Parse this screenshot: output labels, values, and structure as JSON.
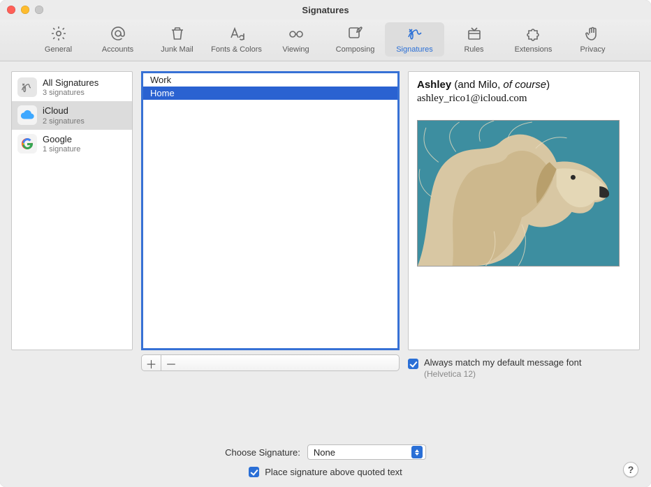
{
  "window": {
    "title": "Signatures"
  },
  "toolbar": {
    "items": [
      {
        "id": "general",
        "label": "General",
        "icon": "gear-icon"
      },
      {
        "id": "accounts",
        "label": "Accounts",
        "icon": "at-icon"
      },
      {
        "id": "junk",
        "label": "Junk Mail",
        "icon": "trash-icon"
      },
      {
        "id": "fonts",
        "label": "Fonts & Colors",
        "icon": "fonts-icon"
      },
      {
        "id": "viewing",
        "label": "Viewing",
        "icon": "glasses-icon"
      },
      {
        "id": "composing",
        "label": "Composing",
        "icon": "compose-icon"
      },
      {
        "id": "signatures",
        "label": "Signatures",
        "icon": "signature-icon",
        "selected": true
      },
      {
        "id": "rules",
        "label": "Rules",
        "icon": "rules-icon"
      },
      {
        "id": "extensions",
        "label": "Extensions",
        "icon": "puzzle-icon"
      },
      {
        "id": "privacy",
        "label": "Privacy",
        "icon": "hand-icon"
      }
    ]
  },
  "accounts": [
    {
      "name": "All Signatures",
      "sub": "3 signatures",
      "icon": "all-signatures-icon"
    },
    {
      "name": "iCloud",
      "sub": "2 signatures",
      "icon": "icloud-icon",
      "selected": true
    },
    {
      "name": "Google",
      "sub": "1 signature",
      "icon": "google-icon"
    }
  ],
  "signatures": [
    {
      "label": "Work"
    },
    {
      "label": "Home",
      "selected": true
    }
  ],
  "preview": {
    "name_bold": "Ashley",
    "name_paren_open": " (and Milo, ",
    "name_italic": "of course",
    "name_paren_close": ")",
    "email": "ashley_rico1@icloud.com",
    "image_alt": "dog-photo"
  },
  "match_font": {
    "checked": true,
    "label": "Always match my default message font",
    "sub": "(Helvetica 12)"
  },
  "choose": {
    "label": "Choose Signature:",
    "value": "None"
  },
  "place_above": {
    "checked": true,
    "label": "Place signature above quoted text"
  },
  "buttons": {
    "add_aria": "Add signature",
    "remove_aria": "Remove signature",
    "help_aria": "Help"
  }
}
